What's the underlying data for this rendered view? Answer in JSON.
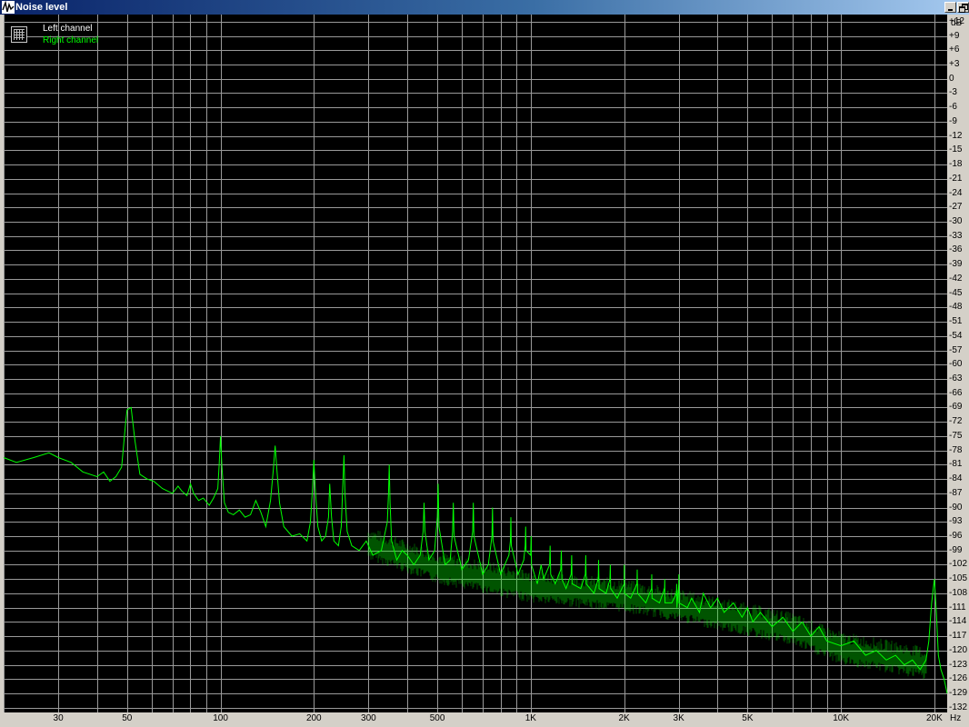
{
  "window": {
    "title": "Noise level"
  },
  "colors": {
    "left_channel": "#ffffff",
    "right_channel": "#00ff00",
    "grid": "#9a9a9a",
    "background": "#000000"
  },
  "chart_data": {
    "type": "line",
    "title": "",
    "xlabel": "Hz",
    "ylabel": "dB",
    "xscale": "log",
    "xlim": [
      20,
      22000
    ],
    "ylim": [
      -133,
      13.5
    ],
    "grid": true,
    "legend_position": "top-left",
    "legend": [
      "Left channel",
      "Right channel"
    ],
    "x_ticks": [
      {
        "label": "30",
        "value": 30
      },
      {
        "label": "50",
        "value": 50
      },
      {
        "label": "100",
        "value": 100
      },
      {
        "label": "200",
        "value": 200
      },
      {
        "label": "300",
        "value": 300
      },
      {
        "label": "500",
        "value": 500
      },
      {
        "label": "1K",
        "value": 1000
      },
      {
        "label": "2K",
        "value": 2000
      },
      {
        "label": "3K",
        "value": 3000
      },
      {
        "label": "5K",
        "value": 5000
      },
      {
        "label": "10K",
        "value": 10000
      },
      {
        "label": "20K",
        "value": 20000
      }
    ],
    "y_ticks": [
      12,
      9,
      6,
      3,
      0,
      -3,
      -6,
      -9,
      -12,
      -15,
      -18,
      -21,
      -24,
      -27,
      -30,
      -33,
      -36,
      -39,
      -42,
      -45,
      -48,
      -51,
      -54,
      -57,
      -60,
      -63,
      -66,
      -69,
      -72,
      -75,
      -78,
      -81,
      -84,
      -87,
      -90,
      -93,
      -96,
      -99,
      -102,
      -105,
      -108,
      -111,
      -114,
      -117,
      -120,
      -123,
      -126,
      -129,
      -132
    ],
    "series": [
      {
        "name": "Right channel",
        "color": "#00ff00",
        "noise_floor": [
          [
            20,
            -79.5
          ],
          [
            50,
            -83
          ],
          [
            100,
            -88
          ],
          [
            150,
            -93
          ],
          [
            200,
            -95
          ],
          [
            300,
            -98
          ],
          [
            500,
            -103
          ],
          [
            700,
            -105
          ],
          [
            1000,
            -107
          ],
          [
            2000,
            -109
          ],
          [
            3000,
            -111
          ],
          [
            5000,
            -114
          ],
          [
            7000,
            -116
          ],
          [
            10000,
            -120
          ],
          [
            15000,
            -122
          ],
          [
            18000,
            -123
          ],
          [
            20000,
            -124
          ],
          [
            22000,
            -128
          ]
        ],
        "points": [
          [
            20,
            -79.5
          ],
          [
            22,
            -80.5
          ],
          [
            25,
            -79.5
          ],
          [
            28,
            -78.5
          ],
          [
            30,
            -79.5
          ],
          [
            33,
            -80.5
          ],
          [
            36,
            -82.5
          ],
          [
            40,
            -83.5
          ],
          [
            42,
            -82.5
          ],
          [
            44,
            -84.5
          ],
          [
            46,
            -83.5
          ],
          [
            48,
            -81.5
          ],
          [
            49.5,
            -72
          ],
          [
            50,
            -69.5
          ],
          [
            51.5,
            -69
          ],
          [
            53,
            -76
          ],
          [
            55,
            -83
          ],
          [
            58,
            -84
          ],
          [
            61,
            -84.5
          ],
          [
            65,
            -86
          ],
          [
            70,
            -87
          ],
          [
            73,
            -85.5
          ],
          [
            75,
            -86.5
          ],
          [
            78,
            -87.5
          ],
          [
            80,
            -85
          ],
          [
            82,
            -87
          ],
          [
            85,
            -88.5
          ],
          [
            88,
            -88
          ],
          [
            92,
            -89.5
          ],
          [
            95,
            -88
          ],
          [
            98,
            -86
          ],
          [
            99,
            -81
          ],
          [
            100,
            -75
          ],
          [
            101,
            -81
          ],
          [
            103,
            -89
          ],
          [
            106,
            -91
          ],
          [
            110,
            -91.5
          ],
          [
            115,
            -90.5
          ],
          [
            120,
            -92
          ],
          [
            125,
            -91.5
          ],
          [
            130,
            -88.5
          ],
          [
            135,
            -91
          ],
          [
            140,
            -94
          ],
          [
            145,
            -88.5
          ],
          [
            148,
            -82
          ],
          [
            150,
            -77
          ],
          [
            152,
            -82
          ],
          [
            155,
            -89
          ],
          [
            160,
            -94
          ],
          [
            170,
            -96
          ],
          [
            180,
            -95.5
          ],
          [
            190,
            -97
          ],
          [
            195,
            -93
          ],
          [
            198,
            -86
          ],
          [
            200,
            -80
          ],
          [
            202,
            -86
          ],
          [
            206,
            -94
          ],
          [
            212,
            -97
          ],
          [
            218,
            -96
          ],
          [
            223,
            -92
          ],
          [
            225,
            -85
          ],
          [
            228,
            -92
          ],
          [
            232,
            -97
          ],
          [
            240,
            -98
          ],
          [
            245,
            -94
          ],
          [
            248,
            -85
          ],
          [
            250,
            -79
          ],
          [
            252,
            -87
          ],
          [
            256,
            -95
          ],
          [
            265,
            -98
          ],
          [
            280,
            -99
          ],
          [
            295,
            -97
          ],
          [
            310,
            -100
          ],
          [
            330,
            -99
          ],
          [
            345,
            -93
          ],
          [
            348,
            -87
          ],
          [
            350,
            -81
          ],
          [
            352,
            -89
          ],
          [
            356,
            -97
          ],
          [
            370,
            -101
          ],
          [
            385,
            -99
          ],
          [
            400,
            -100
          ],
          [
            420,
            -102
          ],
          [
            440,
            -100
          ],
          [
            450,
            -95
          ],
          [
            453,
            -89
          ],
          [
            456,
            -95
          ],
          [
            470,
            -101
          ],
          [
            490,
            -99
          ],
          [
            500,
            -92
          ],
          [
            503,
            -85
          ],
          [
            506,
            -94
          ],
          [
            530,
            -102
          ],
          [
            550,
            -101
          ],
          [
            560,
            -95
          ],
          [
            563,
            -89
          ],
          [
            566,
            -96
          ],
          [
            600,
            -103
          ],
          [
            630,
            -101
          ],
          [
            650,
            -95
          ],
          [
            653,
            -89
          ],
          [
            656,
            -96
          ],
          [
            700,
            -104
          ],
          [
            730,
            -102
          ],
          [
            750,
            -96
          ],
          [
            753,
            -90
          ],
          [
            756,
            -97
          ],
          [
            800,
            -104
          ],
          [
            850,
            -100
          ],
          [
            860,
            -97
          ],
          [
            863,
            -92
          ],
          [
            866,
            -98
          ],
          [
            910,
            -104
          ],
          [
            950,
            -101
          ],
          [
            960,
            -98
          ],
          [
            963,
            -94
          ],
          [
            966,
            -99
          ],
          [
            1000,
            -100
          ],
          [
            1003,
            -96
          ],
          [
            1006,
            -102
          ],
          [
            1050,
            -106
          ],
          [
            1080,
            -102
          ],
          [
            1100,
            -105
          ],
          [
            1150,
            -102
          ],
          [
            1155,
            -98
          ],
          [
            1160,
            -104
          ],
          [
            1200,
            -106
          ],
          [
            1250,
            -103
          ],
          [
            1255,
            -99
          ],
          [
            1260,
            -105
          ],
          [
            1300,
            -107
          ],
          [
            1350,
            -104
          ],
          [
            1355,
            -100
          ],
          [
            1360,
            -106
          ],
          [
            1450,
            -107
          ],
          [
            1500,
            -104
          ],
          [
            1505,
            -100
          ],
          [
            1510,
            -106
          ],
          [
            1600,
            -108
          ],
          [
            1650,
            -105
          ],
          [
            1655,
            -101
          ],
          [
            1660,
            -107
          ],
          [
            1750,
            -108
          ],
          [
            1800,
            -105
          ],
          [
            1805,
            -102
          ],
          [
            1810,
            -107
          ],
          [
            1900,
            -109
          ],
          [
            2000,
            -106
          ],
          [
            2003,
            -102
          ],
          [
            2006,
            -108
          ],
          [
            2100,
            -109
          ],
          [
            2200,
            -106
          ],
          [
            2205,
            -103
          ],
          [
            2210,
            -108
          ],
          [
            2350,
            -110
          ],
          [
            2450,
            -107
          ],
          [
            2455,
            -104
          ],
          [
            2460,
            -109
          ],
          [
            2600,
            -110
          ],
          [
            2700,
            -107
          ],
          [
            2705,
            -105
          ],
          [
            2710,
            -110
          ],
          [
            2850,
            -110
          ],
          [
            2950,
            -108
          ],
          [
            2955,
            -106
          ],
          [
            2960,
            -111
          ],
          [
            3000,
            -106
          ],
          [
            3003,
            -104
          ],
          [
            3006,
            -110
          ],
          [
            3200,
            -111
          ],
          [
            3300,
            -109
          ],
          [
            3500,
            -112
          ],
          [
            3600,
            -108
          ],
          [
            3800,
            -111
          ],
          [
            4000,
            -109
          ],
          [
            4200,
            -112
          ],
          [
            4500,
            -110
          ],
          [
            4800,
            -113
          ],
          [
            5000,
            -111
          ],
          [
            5200,
            -114
          ],
          [
            5500,
            -112
          ],
          [
            6000,
            -115
          ],
          [
            6500,
            -113
          ],
          [
            7000,
            -116
          ],
          [
            7500,
            -114
          ],
          [
            8000,
            -117
          ],
          [
            8500,
            -115
          ],
          [
            9000,
            -118
          ],
          [
            10000,
            -119
          ],
          [
            11000,
            -118
          ],
          [
            12000,
            -121
          ],
          [
            13000,
            -120
          ],
          [
            14000,
            -122
          ],
          [
            15000,
            -121
          ],
          [
            16000,
            -123
          ],
          [
            17000,
            -122
          ],
          [
            18000,
            -124
          ],
          [
            18800,
            -122
          ],
          [
            19200,
            -118
          ],
          [
            19600,
            -110
          ],
          [
            20000,
            -105
          ],
          [
            20300,
            -112
          ],
          [
            20600,
            -121
          ],
          [
            21000,
            -124
          ],
          [
            21500,
            -126
          ],
          [
            22000,
            -129
          ]
        ]
      }
    ]
  }
}
